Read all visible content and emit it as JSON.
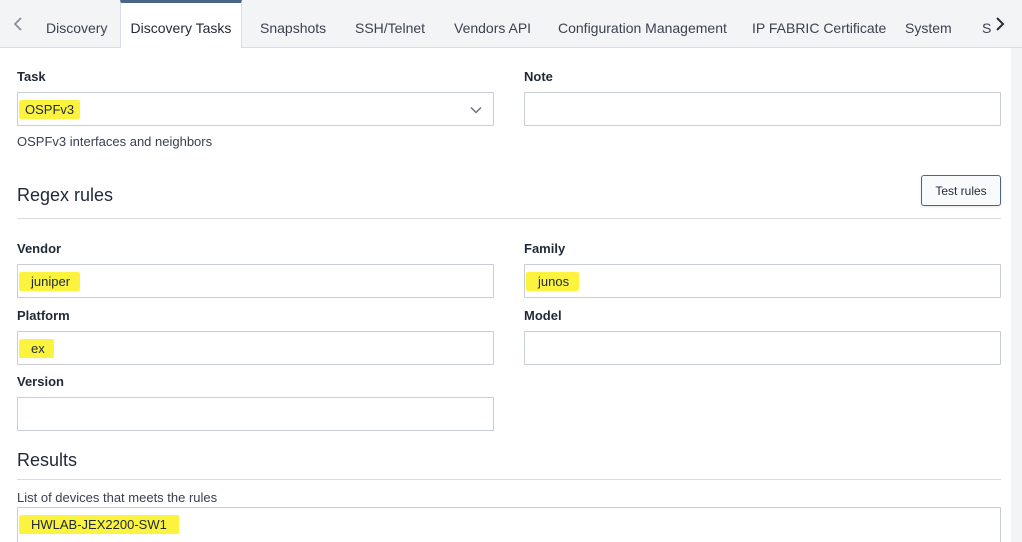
{
  "tabs": {
    "discovery": "Discovery",
    "discovery_tasks": "Discovery Tasks",
    "snapshots": "Snapshots",
    "ssh_telnet": "SSH/Telnet",
    "vendors_api": "Vendors API",
    "configuration_management": "Configuration Management",
    "ip_fabric_certificate": "IP FABRIC Certificate",
    "system": "System",
    "overflow": "S"
  },
  "task": {
    "label": "Task",
    "value": "OSPFv3",
    "description": "OSPFv3 interfaces and neighbors"
  },
  "note": {
    "label": "Note",
    "value": ""
  },
  "regex": {
    "title": "Regex rules",
    "test_button": "Test rules",
    "vendor_label": "Vendor",
    "vendor_value": "juniper",
    "family_label": "Family",
    "family_value": "junos",
    "platform_label": "Platform",
    "platform_value": "ex",
    "model_label": "Model",
    "model_value": "",
    "version_label": "Version",
    "version_value": ""
  },
  "results": {
    "title": "Results",
    "list_label": "List of devices that meets the rules",
    "devices": [
      "HWLAB-JEX2200-SW1"
    ]
  },
  "colors": {
    "highlight": "#fbf33d",
    "accent": "#4b6587"
  },
  "icons": {
    "tab_prev": "chevron-left-icon",
    "tab_next": "chevron-right-icon",
    "select_toggle": "chevron-down-icon"
  }
}
